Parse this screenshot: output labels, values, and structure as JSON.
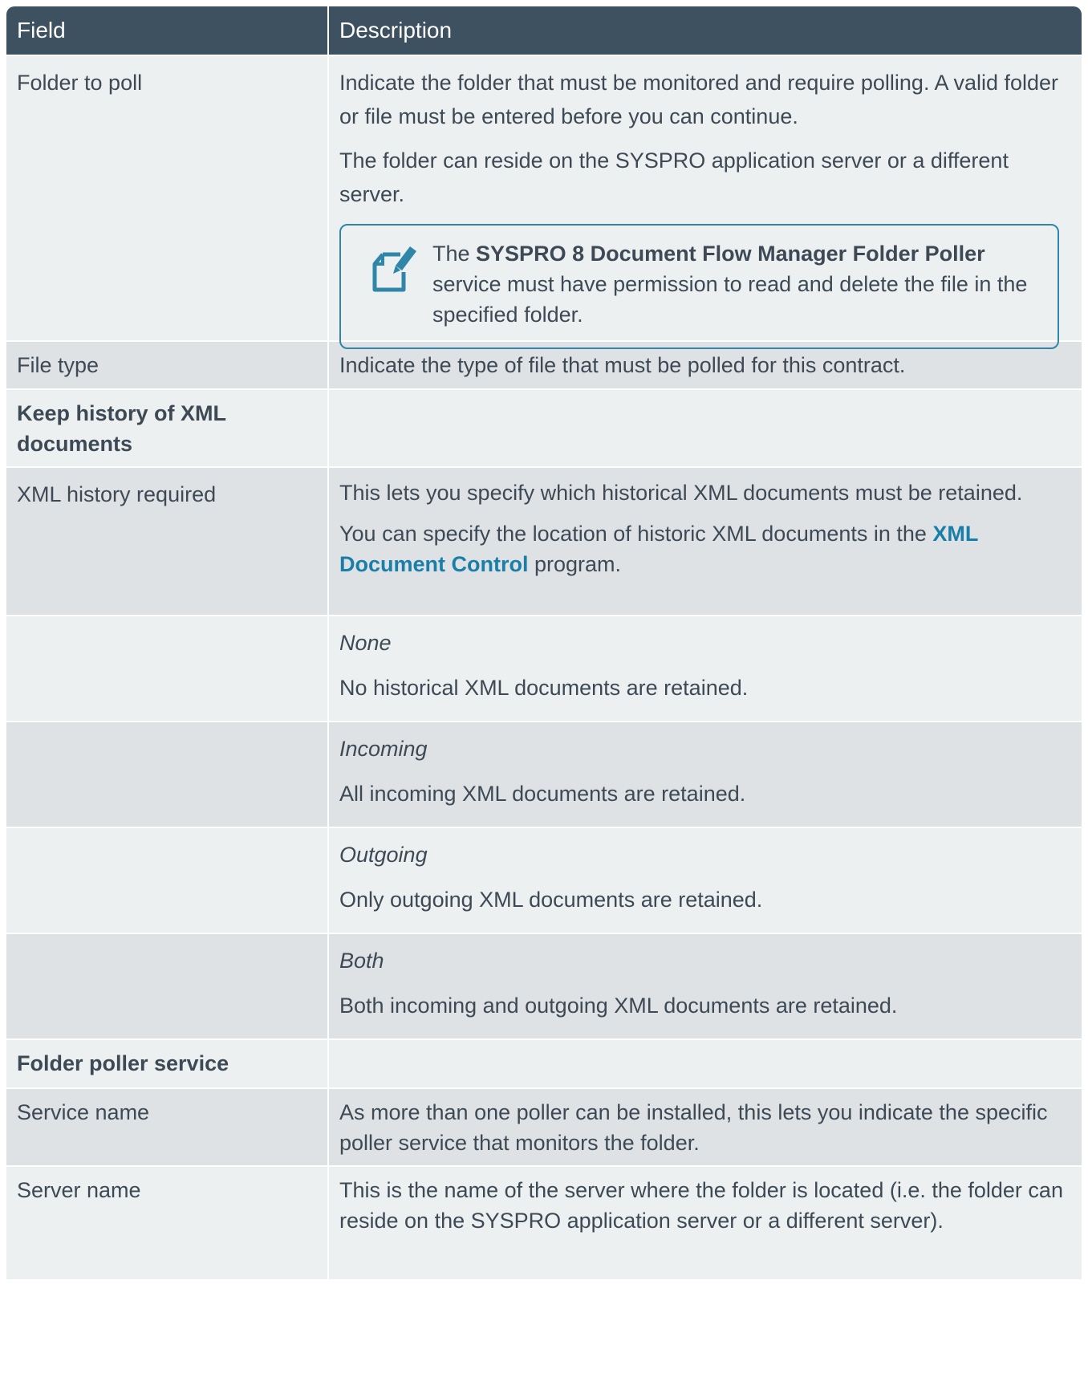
{
  "header": {
    "field": "Field",
    "description": "Description"
  },
  "rows": {
    "folder_to_poll": {
      "field": "Folder to poll",
      "desc_1": "Indicate the folder that must be monitored and require polling. A valid folder or file must be entered before you can continue.",
      "desc_2": "The folder can reside on the SYSPRO application server or a different server.",
      "note": {
        "prefix": "The ",
        "bold": "SYSPRO 8 Document Flow Manager Folder Poller",
        "suffix": " service must have permission to read and delete the file in the specified folder."
      }
    },
    "file_type": {
      "field": "File type",
      "desc": "Indicate the type of file that must be polled for this contract."
    },
    "section_keep_history": {
      "field": "Keep history of XML documents"
    },
    "xml_history_required": {
      "field": "XML history required",
      "desc_1": "This lets you specify which historical XML documents must be retained.",
      "desc_2_prefix": "You can specify the location of historic XML documents in the ",
      "desc_2_link": "XML Document Control",
      "desc_2_suffix": " program."
    },
    "options": [
      {
        "name": "None",
        "desc": "No historical XML documents are retained."
      },
      {
        "name": "Incoming",
        "desc": "All incoming XML documents are retained."
      },
      {
        "name": "Outgoing",
        "desc": "Only outgoing XML documents are retained."
      },
      {
        "name": "Both",
        "desc": "Both incoming and outgoing XML documents are retained."
      }
    ],
    "section_folder_poller": {
      "field": "Folder poller service"
    },
    "service_name": {
      "field": "Service name",
      "desc": "As more than one poller can be installed, this lets you indicate the specific poller service that monitors the folder."
    },
    "server_name": {
      "field": "Server name",
      "desc": "This is the name of the server where the folder is located (i.e. the folder can reside on the SYSPRO application server or a different server)."
    }
  },
  "icons": {
    "note": "note-edit-icon"
  },
  "colors": {
    "header_bg": "#3e5161",
    "row_light": "#edf0f1",
    "row_dark": "#dfe2e5",
    "link": "#1a7fa8",
    "note_border": "#2f86a8"
  }
}
